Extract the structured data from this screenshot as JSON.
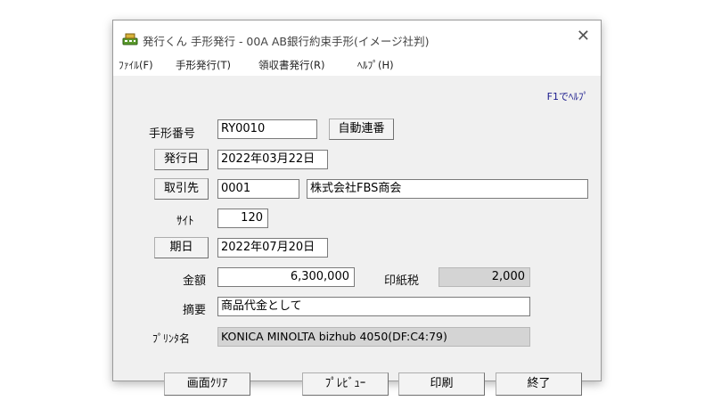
{
  "window": {
    "title": "発行くん 手形発行 - 00A AB銀行約束手形(イメージ社判)",
    "close_glyph": "✕"
  },
  "menu": {
    "file": "ﾌｧｲﾙ(F)",
    "tegata": "手形発行(T)",
    "ryoshu": "領収書発行(R)",
    "help": "ﾍﾙﾌﾟ(H)"
  },
  "help_hint": "F1でﾍﾙﾌﾟ",
  "form": {
    "tegata_no_label": "手形番号",
    "tegata_no_value": "RY0010",
    "auto_number_button": "自動連番",
    "issue_date_button": "発行日",
    "issue_date_value": "2022年03月22日",
    "partner_button": "取引先",
    "partner_code_value": "0001",
    "partner_name_value": "株式会社FBS商会",
    "site_label": "ｻｲﾄ",
    "site_value": "120",
    "due_date_button": "期日",
    "due_date_value": "2022年07月20日",
    "amount_label": "金額",
    "amount_value": "6,300,000",
    "stamp_tax_label": "印紙税",
    "stamp_tax_value": "2,000",
    "memo_label": "摘要",
    "memo_value": "商品代金として",
    "printer_label": "ﾌﾟﾘﾝﾀ名",
    "printer_value": "KONICA MINOLTA bizhub 4050(DF:C4:79)"
  },
  "buttons": {
    "clear": "画面ｸﾘｱ",
    "preview": "ﾌﾟﾚﾋﾞｭｰ",
    "print": "印刷",
    "exit": "終了"
  }
}
